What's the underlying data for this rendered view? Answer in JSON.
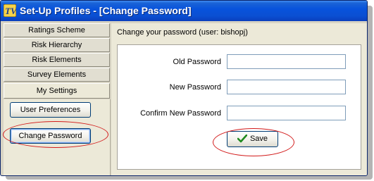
{
  "window": {
    "title": "Set-Up Profiles - [Change Password]",
    "app_icon": "tv-logo-icon"
  },
  "left_nav": {
    "tabs": [
      {
        "label": "Ratings Scheme"
      },
      {
        "label": "Risk Hierarchy"
      },
      {
        "label": "Risk Elements"
      },
      {
        "label": "Survey Elements"
      },
      {
        "label": "My Settings",
        "active": true
      }
    ],
    "buttons": {
      "user_preferences": "User Preferences",
      "change_password": "Change Password"
    }
  },
  "main": {
    "heading": "Change your password (user: bishopj)",
    "fields": {
      "old_password": {
        "label": "Old Password",
        "value": ""
      },
      "new_password": {
        "label": "New Password",
        "value": ""
      },
      "confirm_password": {
        "label": "Confirm New Password",
        "value": ""
      }
    },
    "save_label": "Save",
    "save_icon": "checkmark-icon"
  },
  "annotations": {
    "color": "#d21a1a",
    "highlighted": [
      "change-password-button",
      "save-button"
    ]
  }
}
